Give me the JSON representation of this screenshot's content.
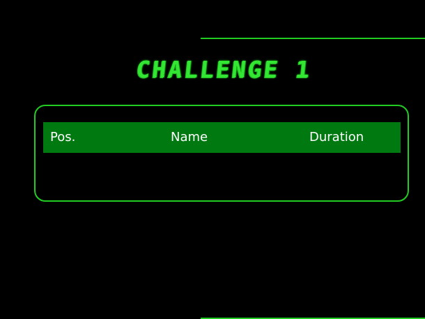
{
  "page": {
    "title": "CHALLENGE 1"
  },
  "leaderboard": {
    "columns": [
      "Pos.",
      "Name",
      "Duration"
    ],
    "rows": []
  },
  "colors": {
    "background": "#000000",
    "accent": "#22cc22",
    "header_fill": "#007a10",
    "header_text": "#ffffff"
  }
}
